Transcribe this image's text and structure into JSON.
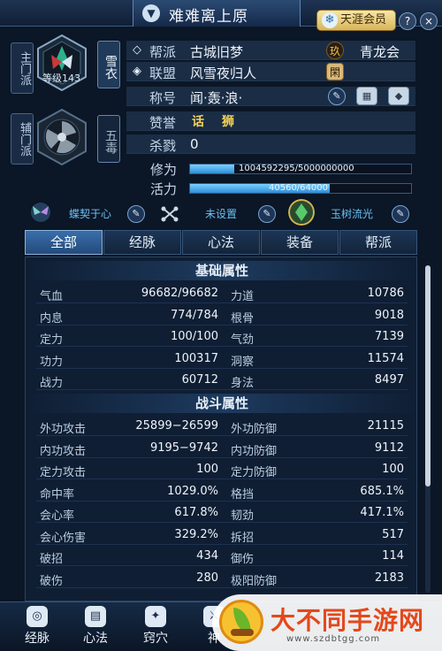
{
  "header": {
    "title": "难难离上原",
    "vip_label": "天涯会员",
    "help_icon": "?",
    "close_icon": "×"
  },
  "character": {
    "main_school_label": "主门派",
    "sub_school_label": "辅门派",
    "level_text": "等级143",
    "main_class": "雪衣",
    "sub_class": "五毒"
  },
  "info": {
    "guild_label": "帮派",
    "guild_value": "古城旧梦",
    "guild_seal": "玖",
    "guild_right": "青龙会",
    "alliance_label": "联盟",
    "alliance_value": "风雪夜归人",
    "alliance_seal": "閑",
    "title_label": "称号",
    "title_value": "闻·轰·浪·",
    "praise_label": "赞誉",
    "praise_badges": [
      "话",
      "狮"
    ],
    "kills_label": "杀戮",
    "kills_value": "0"
  },
  "bars": {
    "cultivation_label": "修为",
    "cultivation_text": "1004592295/5000000000",
    "cultivation_fraction": 0.2009,
    "vitality_label": "活力",
    "vitality_text": "40560/64000",
    "vitality_fraction": 0.6338
  },
  "pets": {
    "pet1": "蝶契于心",
    "pet2": "未设置",
    "pet3": "玉树流光"
  },
  "tabs": [
    "全部",
    "经脉",
    "心法",
    "装备",
    "帮派"
  ],
  "basic": {
    "heading": "基础属性",
    "rows": [
      [
        "气血",
        "96682/96682",
        "力道",
        "10786"
      ],
      [
        "内息",
        "774/784",
        "根骨",
        "9018"
      ],
      [
        "定力",
        "100/100",
        "气劲",
        "7139"
      ],
      [
        "功力",
        "100317",
        "洞察",
        "11574"
      ],
      [
        "战力",
        "60712",
        "身法",
        "8497"
      ]
    ]
  },
  "combat": {
    "heading": "战斗属性",
    "rows": [
      [
        "外功攻击",
        "25899−26599",
        "外功防御",
        "21115"
      ],
      [
        "内功攻击",
        "9195−9742",
        "内功防御",
        "9112"
      ],
      [
        "定力攻击",
        "100",
        "定力防御",
        "100"
      ],
      [
        "命中率",
        "1029.0%",
        "格挡",
        "685.1%"
      ],
      [
        "会心率",
        "617.8%",
        "韧劲",
        "417.1%"
      ],
      [
        "会心伤害",
        "329.2%",
        "拆招",
        "517"
      ],
      [
        "破招",
        "434",
        "御伤",
        "114"
      ],
      [
        "破伤",
        "280",
        "极阳防御",
        "2183"
      ]
    ]
  },
  "bottom_nav": [
    "经脉",
    "心法",
    "窍穴",
    "神"
  ],
  "watermark": {
    "title": "大不同手游网",
    "url": "www.szdbtgg.com"
  }
}
